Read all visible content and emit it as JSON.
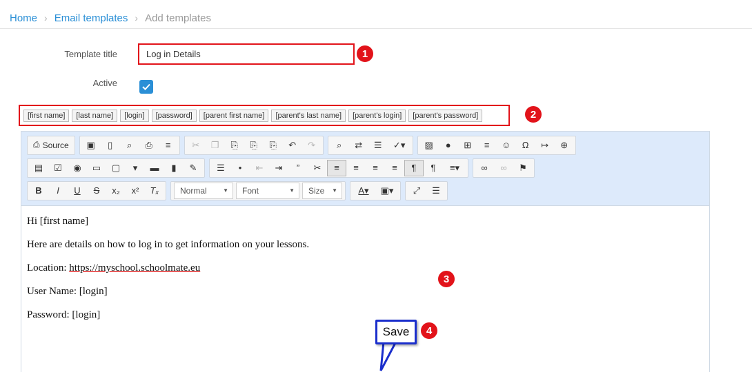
{
  "breadcrumb": {
    "home": "Home",
    "section": "Email templates",
    "current": "Add templates"
  },
  "form": {
    "title_label": "Template title",
    "title_value": "Log in Details",
    "active_label": "Active",
    "active_checked": true
  },
  "placeholders": [
    "[first name]",
    "[last name]",
    "[login]",
    "[password]",
    "[parent first name]",
    "[parent's last name]",
    "[parent's login]",
    "[parent's password]"
  ],
  "toolbar": {
    "source_label": "Source",
    "format_value": "Normal",
    "font_value": "Font",
    "size_value": "Size"
  },
  "content": {
    "greeting": "Hi [first name]",
    "intro": "Here are details on how to log in to get information on your lessons.",
    "location_label": "Location: ",
    "location_url": "https://myschool.schoolmate.eu",
    "username_line": "User Name: [login]",
    "password_line": "Password: [login]"
  },
  "annotations": {
    "one": "1",
    "two": "2",
    "three": "3",
    "four": "4",
    "save_callout": "Save"
  },
  "colors": {
    "accent": "#2a8fd6",
    "highlight": "#e2131a",
    "callout_border": "#1a2ecc",
    "toolbar_bg": "#ddeafb"
  }
}
